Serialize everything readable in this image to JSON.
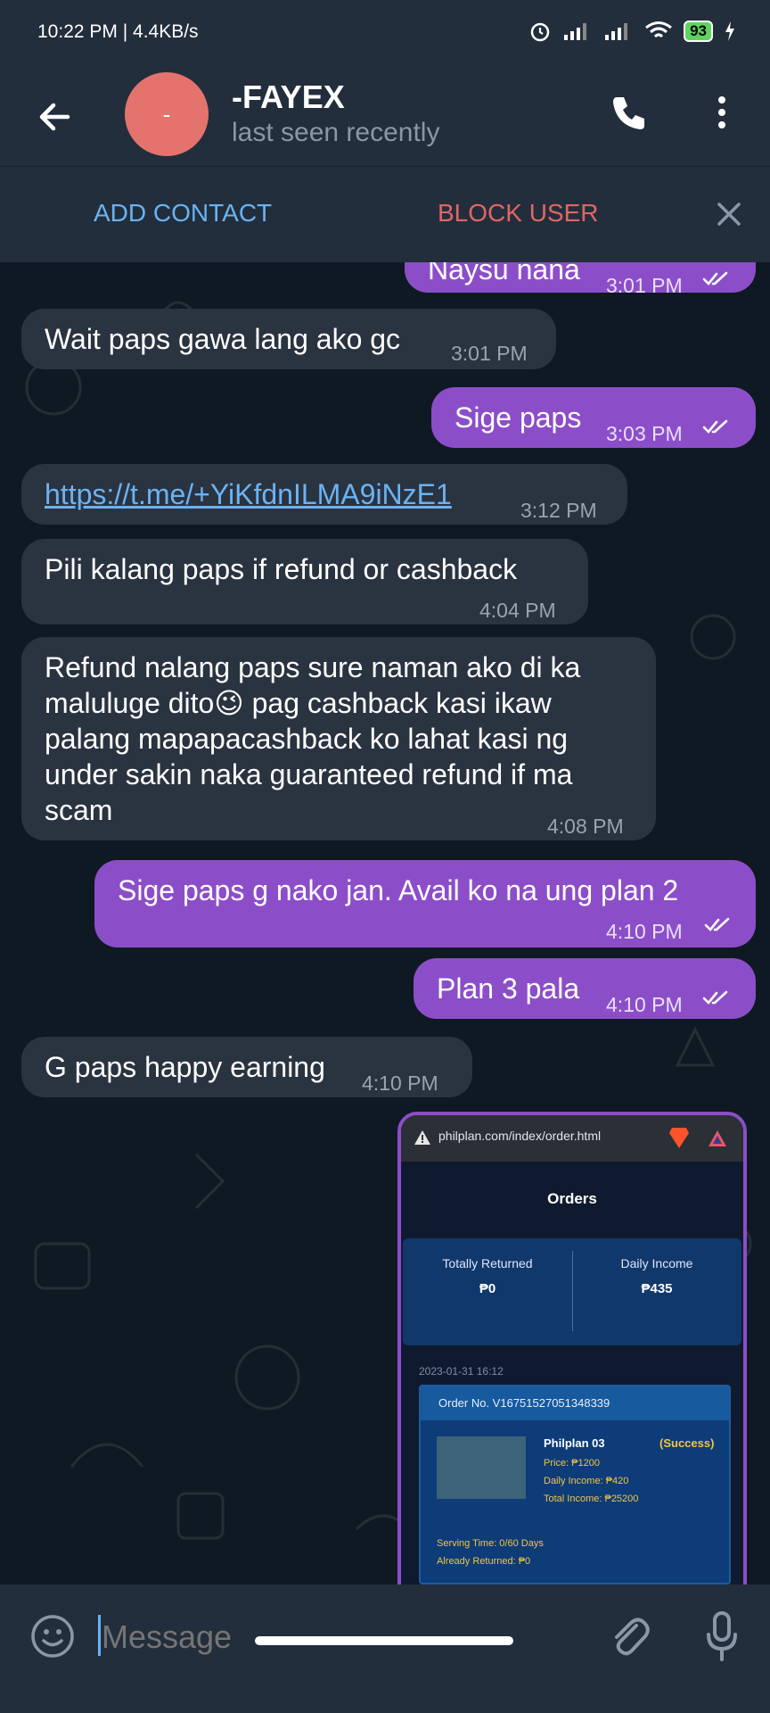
{
  "status_bar": {
    "time_speed": "10:22 PM | 4.4KB/s",
    "battery": "93"
  },
  "header": {
    "name": "-FAYEX",
    "last_seen": "last seen recently",
    "avatar_initial": "-"
  },
  "actions": {
    "add_contact": "ADD CONTACT",
    "block_user": "BLOCK USER"
  },
  "messages": [
    {
      "dir": "out",
      "text": "Naysu nana",
      "time": "3:01 PM"
    },
    {
      "dir": "in",
      "text": "Wait paps gawa lang ako gc",
      "time": "3:01 PM"
    },
    {
      "dir": "out",
      "text": "Sige paps",
      "time": "3:03 PM"
    },
    {
      "dir": "in",
      "text": "https://t.me/+YiKfdnILMA9iNzE1",
      "time": "3:12 PM"
    },
    {
      "dir": "in",
      "text": "Pili kalang paps if refund or cashback",
      "time": "4:04 PM"
    },
    {
      "dir": "in",
      "lines": [
        "Refund nalang paps sure naman ako di ka",
        "maluluge dito😉 pag cashback kasi ikaw",
        "palang mapapacashback ko lahat kasi ng",
        "under sakin naka guaranteed refund if ma",
        "scam"
      ],
      "time": "4:08 PM"
    },
    {
      "dir": "out",
      "text": "Sige paps g nako jan. Avail ko na ung plan 2",
      "time": "4:10 PM"
    },
    {
      "dir": "out",
      "text": "Plan 3 pala",
      "time": "4:10 PM"
    },
    {
      "dir": "in",
      "text": "G paps happy earning",
      "time": "4:10 PM"
    }
  ],
  "screenshot": {
    "url": "philplan.com/index/order.html",
    "title": "Orders",
    "totally_returned_label": "Totally Returned",
    "totally_returned_value": "₱0",
    "daily_income_label": "Daily Income",
    "daily_income_value": "₱435",
    "date": "2023-01-31 16:12",
    "order_no": "Order No. V16751527051348339",
    "product": "Philplan 03",
    "status": "(Success)",
    "price": "Price: ₱1200",
    "daily_income": "Daily Income: ₱420",
    "total_income": "Total Income: ₱25200",
    "serving_time": "Serving Time: 0/60 Days",
    "already_returned": "Already Returned: ₱0"
  },
  "composer": {
    "placeholder": "Message"
  },
  "colors": {
    "outgoing": "#8c4ec8",
    "incoming": "#2a3340",
    "accent": "#6ab3f3",
    "danger": "#e06666"
  }
}
